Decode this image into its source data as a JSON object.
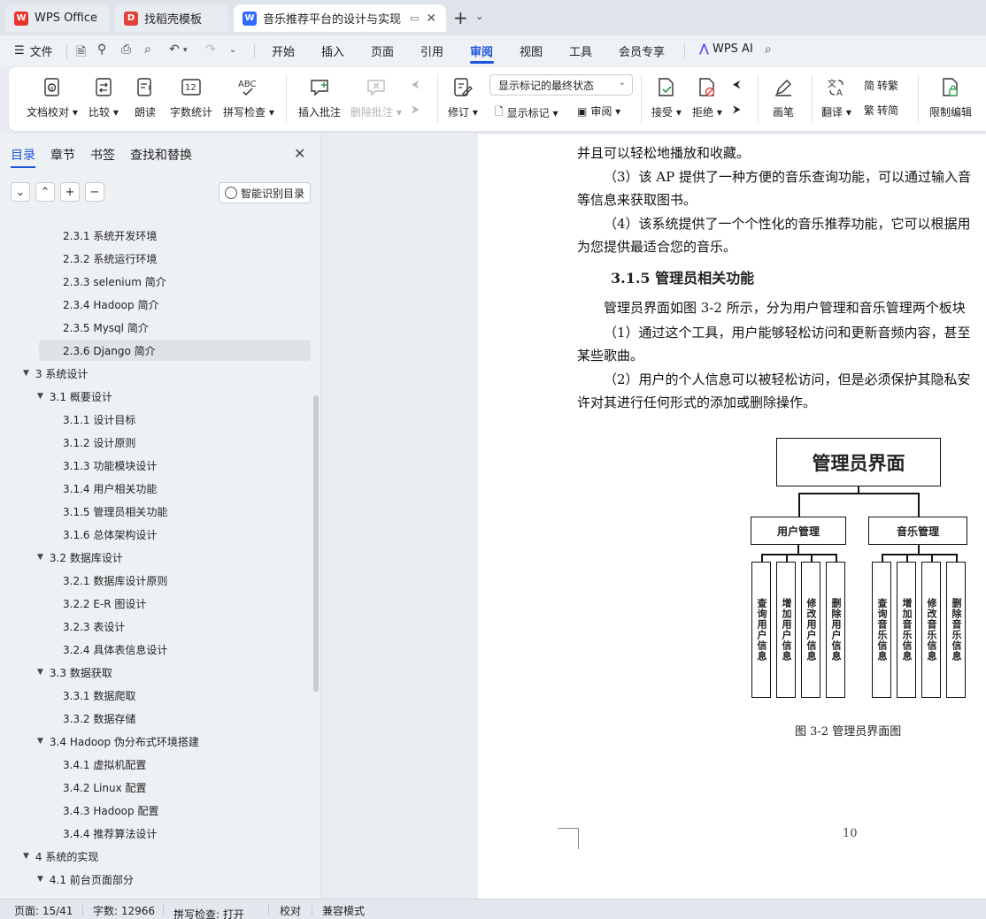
{
  "tabs": [
    {
      "label": "WPS Office",
      "icon": "wps-logo-icon"
    },
    {
      "label": "找稻壳模板",
      "icon": "docer-logo-icon"
    },
    {
      "label": "音乐推荐平台的设计与实现 毕",
      "icon": "writer-doc-icon"
    }
  ],
  "menu": {
    "file": "文件",
    "tabs": [
      "开始",
      "插入",
      "页面",
      "引用",
      "审阅",
      "视图",
      "工具",
      "会员专享"
    ],
    "active_tab": "审阅",
    "wps_ai": "WPS AI"
  },
  "ribbon": {
    "doc_check": "文档校对",
    "compare": "比较",
    "read_aloud": "朗读",
    "word_count": "字数统计",
    "spell_check": "拼写检查",
    "insert_comment": "插入批注",
    "delete_comment": "删除批注",
    "revise": "修订",
    "show_markup": "显示标记",
    "review": "审阅",
    "markup_state": "显示标记的最终状态",
    "accept": "接受",
    "reject": "拒绝",
    "pen": "画笔",
    "translate": "翻译",
    "to_traditional": "转繁",
    "to_simplified": "转简",
    "restrict_edit": "限制编辑",
    "abc_label": "ABC",
    "count_label": "12"
  },
  "panel": {
    "tabs": [
      "目录",
      "章节",
      "书签",
      "查找和替换"
    ],
    "active_tab": "目录",
    "smart_toc": "智能识别目录",
    "toc": [
      {
        "text": "2.3.1 系统开发环境",
        "level": 3
      },
      {
        "text": "2.3.2 系统运行环境",
        "level": 3
      },
      {
        "text": "2.3.3 selenium 简介",
        "level": 3
      },
      {
        "text": "2.3.4 Hadoop 简介",
        "level": 3
      },
      {
        "text": "2.3.5 Mysql 简介",
        "level": 3
      },
      {
        "text": "2.3.6 Django 简介",
        "level": 3,
        "selected": true
      },
      {
        "text": "3 系统设计",
        "level": 1
      },
      {
        "text": "3.1  概要设计",
        "level": 2
      },
      {
        "text": "3.1.1 设计目标",
        "level": 3
      },
      {
        "text": "3.1.2  设计原则",
        "level": 3
      },
      {
        "text": "3.1.3  功能模块设计",
        "level": 3
      },
      {
        "text": "3.1.4  用户相关功能",
        "level": 3
      },
      {
        "text": "3.1.5  管理员相关功能",
        "level": 3
      },
      {
        "text": "3.1.6  总体架构设计",
        "level": 3
      },
      {
        "text": "3.2  数据库设计",
        "level": 2
      },
      {
        "text": "3.2.1 数据库设计原则",
        "level": 3
      },
      {
        "text": "3.2.2 E-R 图设计",
        "level": 3
      },
      {
        "text": "3.2.3 表设计",
        "level": 3
      },
      {
        "text": "3.2.4 具体表信息设计",
        "level": 3
      },
      {
        "text": "3.3 数据获取",
        "level": 2
      },
      {
        "text": "3.3.1 数据爬取",
        "level": 3
      },
      {
        "text": "3.3.2  数据存储",
        "level": 3
      },
      {
        "text": "3.4 Hadoop 伪分布式环境搭建",
        "level": 2
      },
      {
        "text": "3.4.1 虚拟机配置",
        "level": 3
      },
      {
        "text": "3.4.2 Linux 配置",
        "level": 3
      },
      {
        "text": "3.4.3 Hadoop 配置",
        "level": 3
      },
      {
        "text": "3.4.4 推荐算法设计",
        "level": 3
      },
      {
        "text": "4 系统的实现",
        "level": 1
      },
      {
        "text": "4.1  前台页面部分",
        "level": 2
      }
    ]
  },
  "doc": {
    "lines": [
      "并且可以轻松地播放和收藏。",
      "（3）该 AP 提供了一种方便的音乐查询功能，可以通过输入音",
      "等信息来获取图书。",
      "（4）该系统提供了一个个性化的音乐推荐功能，它可以根据用",
      "为您提供最适合您的音乐。",
      "管理员界面如图 3-2 所示，分为用户管理和音乐管理两个板块",
      "（1）通过这个工具，用户能够轻松访问和更新音频内容，甚至",
      "某些歌曲。",
      "（2）用户的个人信息可以被轻松访问，但是必须保护其隐私安",
      "许对其进行任何形式的添加或删除操作。"
    ],
    "heading": "3.1.5  管理员相关功能",
    "diagram": {
      "root": "管理员界面",
      "branches": [
        {
          "name": "用户管理",
          "leaves": [
            "查询用户信息",
            "增加用户信息",
            "修改用户信息",
            "删除用户信息"
          ]
        },
        {
          "name": "音乐管理",
          "leaves": [
            "查询音乐信息",
            "增加音乐信息",
            "修改音乐信息",
            "删除音乐信息"
          ]
        }
      ]
    },
    "caption": "图 3-2 管理员界面图",
    "page_number": "10"
  },
  "status": {
    "page": "页面: 15/41",
    "words": "字数: 12966",
    "spell": "拼写检查: 打开",
    "proof": "校对",
    "compat": "兼容模式"
  },
  "colors": {
    "accent": "#1a56db",
    "wps_red": "#e8342e",
    "docer_red": "#e0433a",
    "writer_blue": "#2f6bff"
  }
}
